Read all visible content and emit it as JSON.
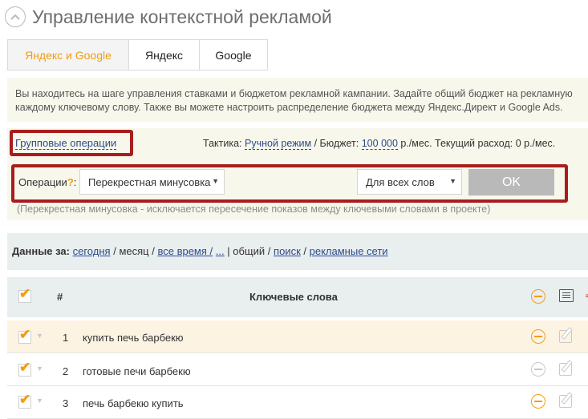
{
  "header": {
    "title": "Управление контекстной рекламой"
  },
  "tabs": [
    {
      "label": "Яндекс и Google",
      "active": true
    },
    {
      "label": "Яндекс",
      "active": false
    },
    {
      "label": "Google",
      "active": false
    }
  ],
  "info": {
    "line1": "Вы находитесь на шаге управления ставками и бюджетом рекламной кампании. Задайте общий бюджет на рекламную",
    "line2": "каждому ключевому слову. Также вы можете настроить распределение бюджета между Яндекс.Директ и Google Ads."
  },
  "group_ops": {
    "label": "Групповые операции",
    "tactic_label": "Тактика:",
    "tactic_value": "Ручной режим",
    "budget_label": "/ Бюджет:",
    "budget_value": "100 000",
    "budget_rest": "р./мес. Текущий расход: 0 р./мес.",
    "operations_label": "Операции",
    "operations_help": "?",
    "operations_colon": ":",
    "operation_selected": "Перекрестная минусовка",
    "scope_selected": "Для всех слов",
    "ok_label": "OK",
    "hint": "(Перекрестная минусовка - исключается пересечение показов между ключевыми словами в проекте)"
  },
  "data_for": {
    "label": "Данные за:",
    "today": "сегодня",
    "sep1": "/",
    "month": "месяц",
    "sep2": "/",
    "all_time": "все время /",
    "ellipsis": "...",
    "sep3": "|",
    "total": "общий",
    "sep4": "/",
    "search": "поиск",
    "sep5": "/",
    "networks": "рекламные сети"
  },
  "table": {
    "col_num": "#",
    "col_keywords": "Ключевые слова",
    "rows": [
      {
        "num": "1",
        "keyword": "купить печь барбекю",
        "minus_active": true
      },
      {
        "num": "2",
        "keyword": "готовые печи барбекю",
        "minus_active": false
      },
      {
        "num": "3",
        "keyword": "печь барбекю купить",
        "minus_active": true
      }
    ]
  },
  "colors": {
    "accent": "#f39c12",
    "link": "#2a4b8d",
    "highlight": "#a81d1d",
    "panel": "#f8f7ec"
  }
}
